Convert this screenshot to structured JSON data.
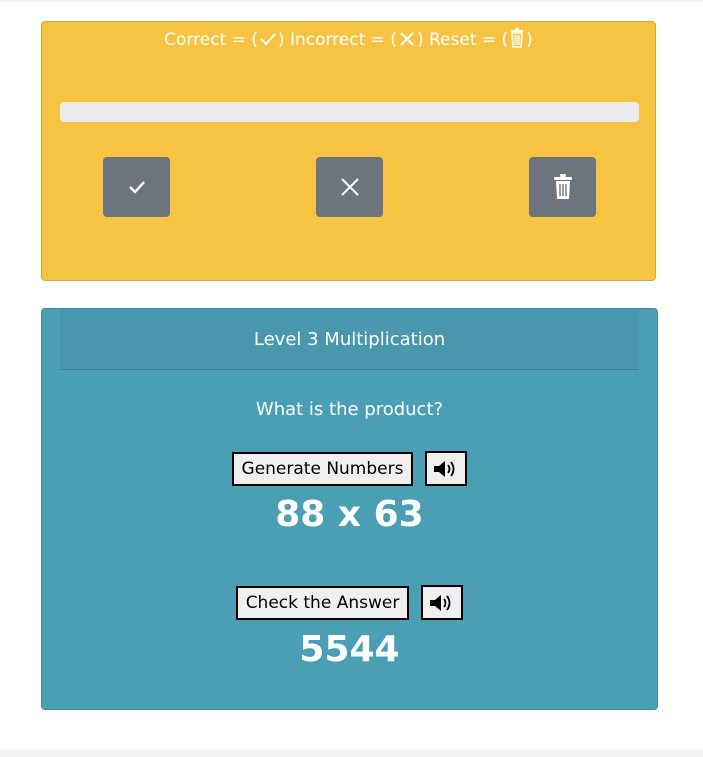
{
  "score_panel": {
    "legend": {
      "correct_label": "Correct = (",
      "correct_close": ") Incorrect = (",
      "incorrect_close": ") Reset = (",
      "reset_close": ")"
    },
    "progress": 0,
    "buttons": {
      "correct_icon": "check-icon",
      "incorrect_icon": "x-icon",
      "reset_icon": "trash-icon"
    },
    "colors": {
      "panel": "#f7c343",
      "button": "#6c757d"
    }
  },
  "quiz": {
    "title": "Level 3 Multiplication",
    "prompt": "What is the product?",
    "generate_label": "Generate Numbers",
    "problem": "88 x 63",
    "check_label": "Check the Answer",
    "answer": "5544",
    "speaker_icon": "speaker-icon",
    "colors": {
      "panel": "#4a9fb5"
    }
  }
}
